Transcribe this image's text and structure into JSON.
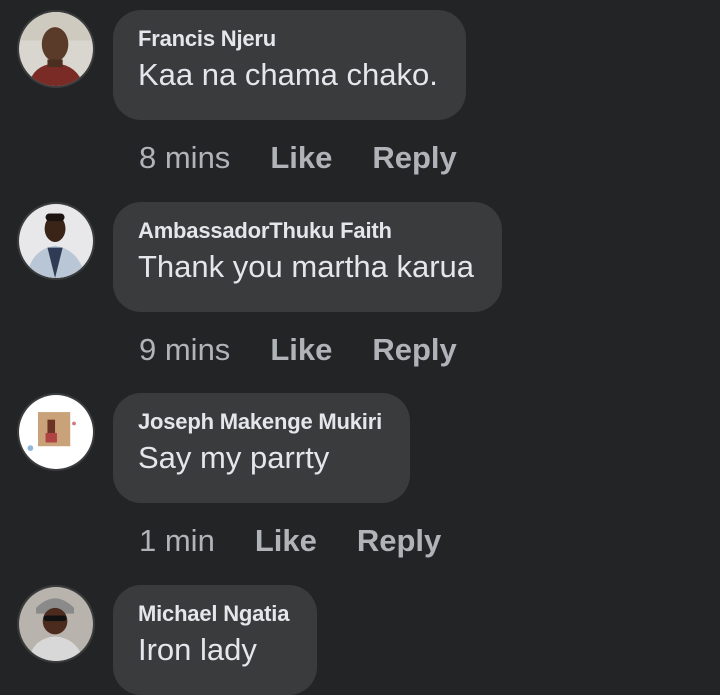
{
  "comments": [
    {
      "author": "Francis Njeru",
      "text": "Kaa na chama chako.",
      "time": "8 mins",
      "like": "Like",
      "reply": "Reply"
    },
    {
      "author": "AmbassadorThuku Faith",
      "text": "Thank you martha karua",
      "time": "9 mins",
      "like": "Like",
      "reply": "Reply"
    },
    {
      "author": "Joseph Makenge Mukiri",
      "text": "Say my parrty",
      "time": "1 min",
      "like": "Like",
      "reply": "Reply"
    },
    {
      "author": "Michael Ngatia",
      "text": "Iron lady"
    }
  ],
  "colors": {
    "background": "#232426",
    "bubble": "#3a3b3c",
    "text_primary": "#e4e6eb",
    "text_secondary": "#b0b3b8"
  },
  "icons": [
    "avatar-francis-njeru",
    "avatar-ambassadorthuku-faith",
    "avatar-joseph-makenge-mukiri",
    "avatar-michael-ngatia"
  ]
}
